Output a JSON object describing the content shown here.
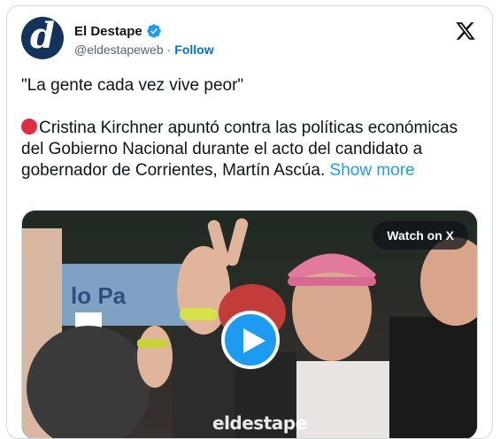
{
  "author": {
    "display_name": "El Destape",
    "handle": "@eldestapeweb",
    "separator": "·",
    "follow_label": "Follow",
    "avatar_letter": "d"
  },
  "tweet": {
    "quote_line": "\"La gente cada vez vive peor\"",
    "body": "Cristina Kirchner apuntó contra las políticas económicas del Gobierno Nacional durante el acto del candidato a gobernador de Corrientes, Martín Ascúa.",
    "show_more": "Show more"
  },
  "media": {
    "watch_label": "Watch on X",
    "watermark": "eldestape"
  },
  "colors": {
    "accent": "#1d9bf0",
    "follow_link": "#006fd6",
    "verified": "#1d9bf0",
    "avatar_bg": "#13335c",
    "red_circle": "#dd2e44"
  },
  "icons": {
    "verified": "verified-badge-icon",
    "x_logo": "x-logo-icon",
    "play": "play-icon",
    "red_circle": "red-circle-emoji"
  }
}
